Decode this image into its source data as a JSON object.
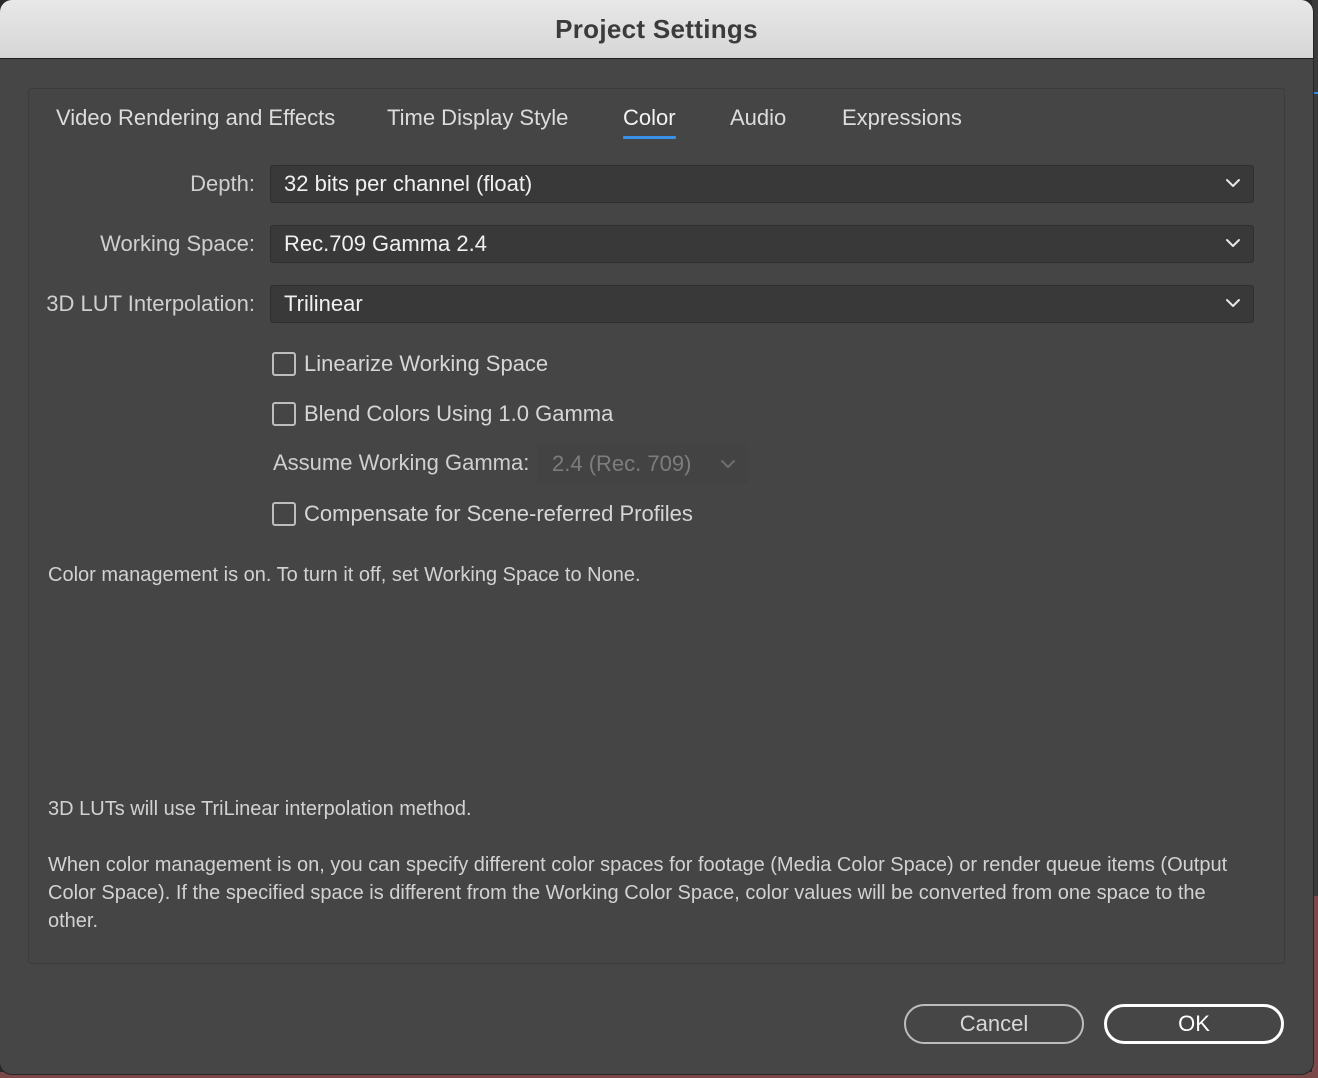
{
  "window": {
    "title": "Project Settings"
  },
  "tabs": [
    {
      "label": "Video Rendering and Effects",
      "active": false
    },
    {
      "label": "Time Display Style",
      "active": false
    },
    {
      "label": "Color",
      "active": true
    },
    {
      "label": "Audio",
      "active": false
    },
    {
      "label": "Expressions",
      "active": false
    }
  ],
  "fields": {
    "depth": {
      "label": "Depth:",
      "value": "32 bits per channel (float)"
    },
    "working_space": {
      "label": "Working Space:",
      "value": "Rec.709 Gamma 2.4"
    },
    "lut_interpolation": {
      "label": "3D LUT Interpolation:",
      "value": "Trilinear"
    }
  },
  "checkboxes": {
    "linearize": {
      "label": "Linearize Working Space",
      "checked": false
    },
    "blend_colors": {
      "label": "Blend Colors Using 1.0 Gamma",
      "checked": false
    },
    "compensate": {
      "label": "Compensate for Scene-referred Profiles",
      "checked": false
    }
  },
  "assume_gamma": {
    "label": "Assume Working Gamma:",
    "value": "2.4 (Rec. 709)",
    "enabled": false
  },
  "info": {
    "color_management": "Color management is on. To turn it off, set Working Space to None.",
    "lut_note": "3D LUTs will use TriLinear interpolation method.",
    "description": "When color management is on, you can specify different color spaces for footage (Media Color Space) or render queue items (Output Color Space). If the specified space is different from the Working Color Space, color values will be converted from one space to the other."
  },
  "buttons": {
    "cancel": "Cancel",
    "ok": "OK"
  },
  "colors": {
    "accent": "#3a8fe6",
    "dialog_bg": "#464646",
    "field_bg": "#393939"
  },
  "icons": {
    "dropdown": "chevron-down-icon"
  }
}
